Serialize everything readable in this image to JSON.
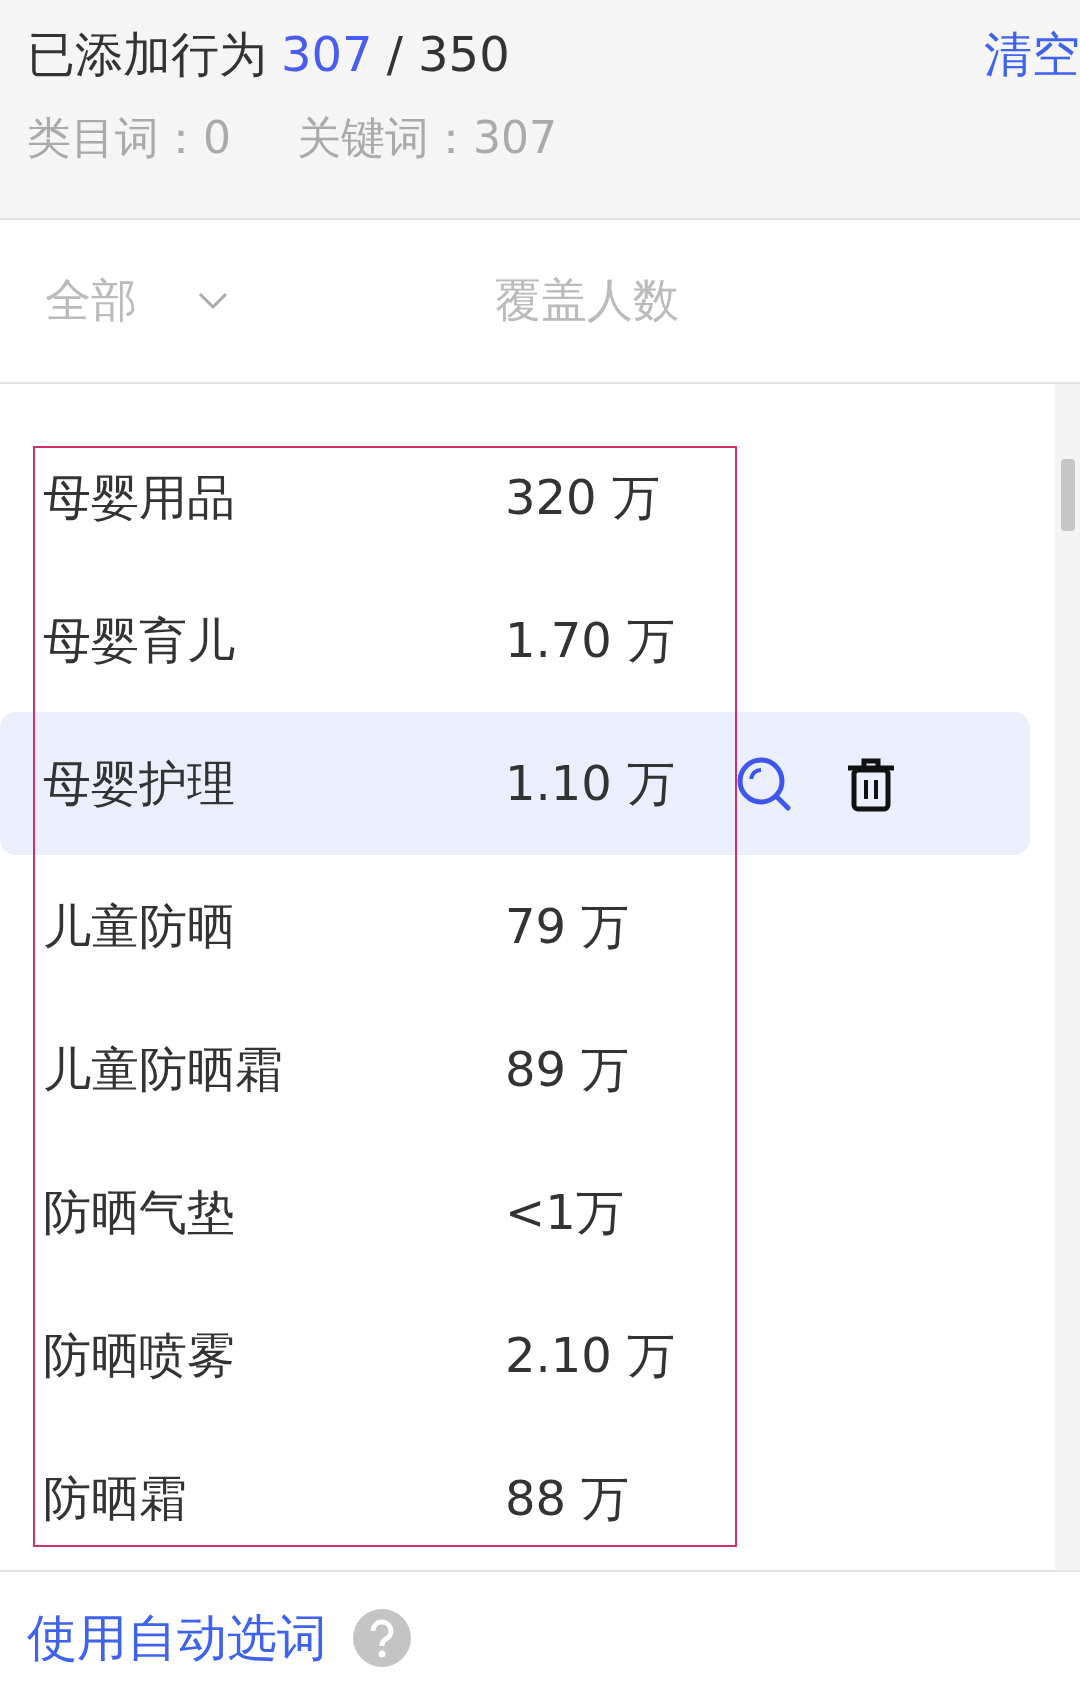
{
  "header": {
    "title": "已添加行为",
    "added": "307",
    "limit": "/ 350",
    "clear": "清空",
    "counts": [
      "类目词：0",
      "关键词：307"
    ]
  },
  "filter": {
    "dropdown": "全部",
    "column": "覆盖人数"
  },
  "rows": [
    {
      "name": "母婴用品",
      "coverage": "320 万",
      "selected": false
    },
    {
      "name": "母婴育儿",
      "coverage": "1.70 万",
      "selected": false
    },
    {
      "name": "母婴护理",
      "coverage": "1.10 万",
      "selected": true
    },
    {
      "name": "儿童防晒",
      "coverage": "79 万",
      "selected": false
    },
    {
      "name": "儿童防晒霜",
      "coverage": "89 万",
      "selected": false
    },
    {
      "name": "防晒气垫",
      "coverage": "<1万",
      "selected": false
    },
    {
      "name": "防晒喷雾",
      "coverage": "2.10 万",
      "selected": false
    },
    {
      "name": "防晒霜",
      "coverage": "88 万",
      "selected": false
    }
  ],
  "footer": {
    "link": "使用自动选词"
  }
}
